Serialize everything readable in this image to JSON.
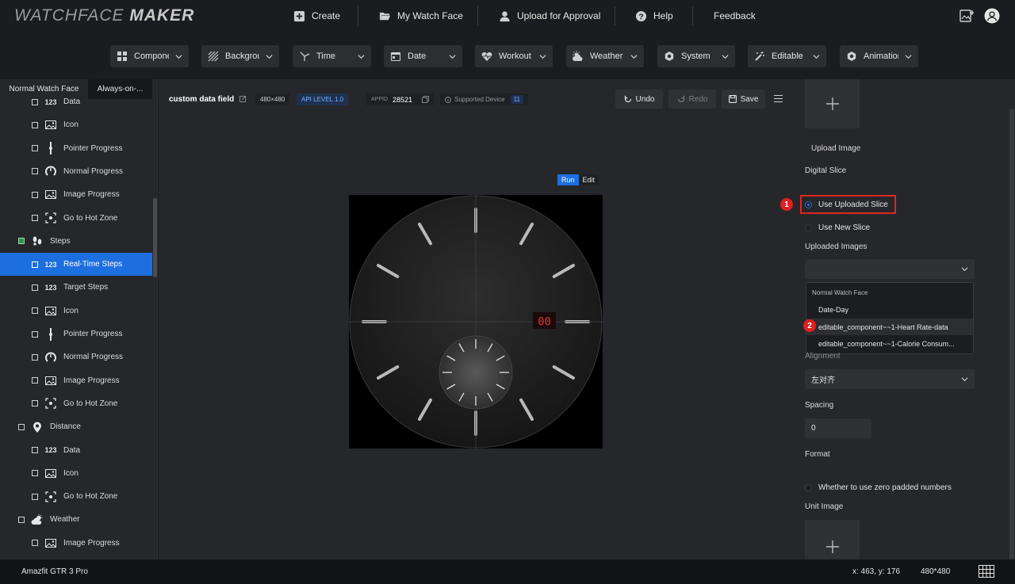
{
  "app": {
    "logo_left": "WATCHFACE",
    "logo_right": "MAKER"
  },
  "topnav": {
    "create": "Create",
    "my_watch_face": "My Watch Face",
    "upload": "Upload for Approval",
    "help": "Help",
    "feedback": "Feedback"
  },
  "components": [
    {
      "label": "Compone..."
    },
    {
      "label": "Background"
    },
    {
      "label": "Time"
    },
    {
      "label": "Date"
    },
    {
      "label": "Workout ..."
    },
    {
      "label": "Weather"
    },
    {
      "label": "System"
    },
    {
      "label": "Editable"
    },
    {
      "label": "Animation"
    }
  ],
  "sidebar": {
    "tabs": [
      "Normal Watch Face",
      "Always-on-..."
    ],
    "items": [
      {
        "label": "Data",
        "icon": "123",
        "level": 1
      },
      {
        "label": "Icon",
        "icon": "image-icon",
        "level": 1
      },
      {
        "label": "Pointer Progress",
        "icon": "pointer-icon",
        "level": 1
      },
      {
        "label": "Normal Progress",
        "icon": "arc-icon",
        "level": 1
      },
      {
        "label": "Image Progress",
        "icon": "image-icon",
        "level": 1
      },
      {
        "label": "Go to Hot Zone",
        "icon": "hotzone-icon",
        "level": 1
      },
      {
        "label": "Steps",
        "icon": "footsteps-icon",
        "level": 0
      },
      {
        "label": "Real-Time Steps",
        "icon": "123",
        "level": 1
      },
      {
        "label": "Target Steps",
        "icon": "123",
        "level": 1
      },
      {
        "label": "Icon",
        "icon": "image-icon",
        "level": 1
      },
      {
        "label": "Pointer Progress",
        "icon": "pointer-icon",
        "level": 1
      },
      {
        "label": "Normal Progress",
        "icon": "arc-icon",
        "level": 1
      },
      {
        "label": "Image Progress",
        "icon": "image-icon",
        "level": 1
      },
      {
        "label": "Go to Hot Zone",
        "icon": "hotzone-icon",
        "level": 1
      },
      {
        "label": "Distance",
        "icon": "location-pin-icon",
        "level": 0
      },
      {
        "label": "Data",
        "icon": "123",
        "level": 1
      },
      {
        "label": "Icon",
        "icon": "image-icon",
        "level": 1
      },
      {
        "label": "Go to Hot Zone",
        "icon": "hotzone-icon",
        "level": 1
      },
      {
        "label": "Weather",
        "icon": "weather-icon",
        "level": 0
      },
      {
        "label": "Image Progress",
        "icon": "image-icon",
        "level": 1
      }
    ],
    "selected_index": 7
  },
  "canvas": {
    "title": "custom data field",
    "resolution_chip": "480×480",
    "api_level": "API LEVEL 1.0",
    "appid_label": "APPID",
    "appid_value": "28521",
    "supported_label": "Supported Device",
    "supported_count": "11",
    "undo": "Undo",
    "redo": "Redo",
    "save": "Save",
    "run": "Run",
    "edit": "Edit",
    "digital_value": "00"
  },
  "right_panel": {
    "upload_image": "Upload Image",
    "digital_slice": "Digital Slice",
    "use_uploaded_slice": "Use Uploaded Slice",
    "use_new_slice": "Use New Slice",
    "uploaded_images": "Uploaded Images",
    "dropdown_group": "Normal Watch Face",
    "dropdown_items": [
      "Date-Day",
      "editable_component~~1-Heart Rate-data",
      "editable_component~~1-Calorie Consum..."
    ],
    "alignment_label": "Alignment",
    "alignment_value": "左对齐",
    "spacing_label": "Spacing",
    "spacing_value": "0",
    "format_label": "Format",
    "zero_padded": "Whether to use zero padded numbers",
    "unit_image": "Unit Image",
    "badge_1": "1",
    "badge_2": "2"
  },
  "status": {
    "device": "Amazfit GTR 3 Pro",
    "coords": "x: 463, y: 176",
    "resolution": "480*480"
  },
  "colors": {
    "accent": "#1d6fe0",
    "annotation_red": "#e02424",
    "digit_red": "#e53030"
  }
}
